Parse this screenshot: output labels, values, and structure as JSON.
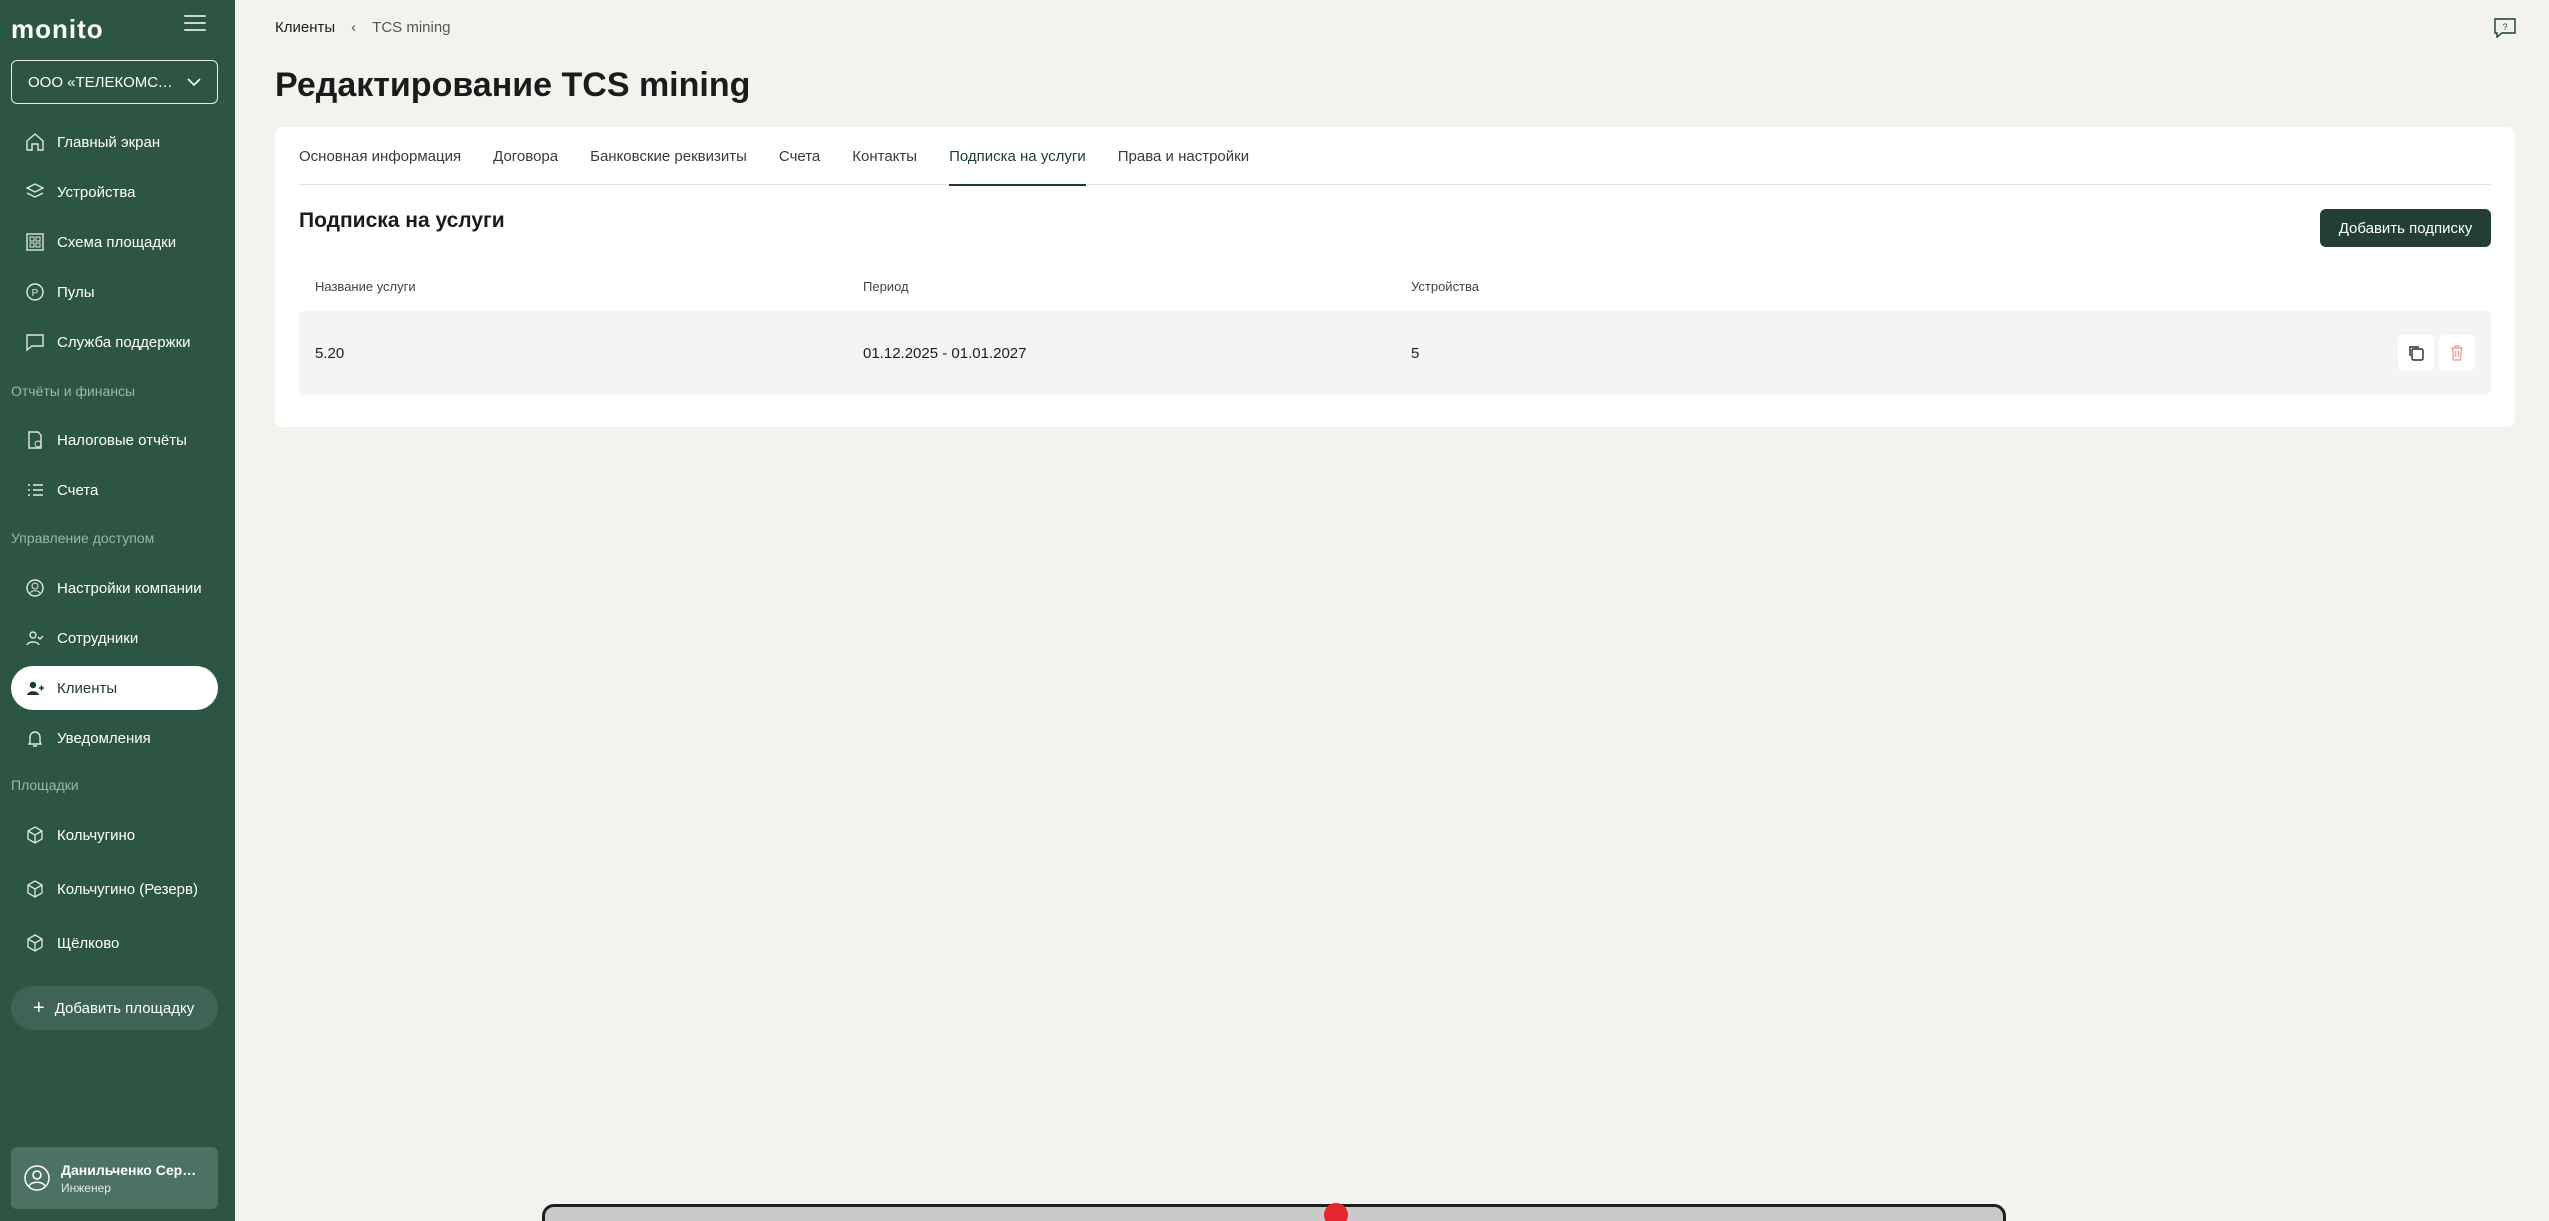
{
  "app": {
    "logo": "monito"
  },
  "company_selector": {
    "value": "ООО «ТЕЛЕКОМСТАНДАРТ»"
  },
  "sidebar": {
    "items": [
      {
        "label": "Главный экран",
        "icon": "home-icon"
      },
      {
        "label": "Устройства",
        "icon": "layers-icon"
      },
      {
        "label": "Схема площадки",
        "icon": "grid-icon"
      },
      {
        "label": "Пулы",
        "icon": "pool-icon"
      },
      {
        "label": "Служба поддержки",
        "icon": "chat-icon"
      }
    ],
    "section_finance": "Отчёты и финансы",
    "finance_items": [
      {
        "label": "Налоговые отчёты",
        "icon": "tax-report-icon"
      },
      {
        "label": "Счета",
        "icon": "list-icon"
      }
    ],
    "section_access": "Управление доступом",
    "access_items": [
      {
        "label": "Настройки компании",
        "icon": "user-circle-icon"
      },
      {
        "label": "Сотрудники",
        "icon": "employees-icon"
      },
      {
        "label": "Клиенты",
        "icon": "clients-icon",
        "active": true
      },
      {
        "label": "Уведомления",
        "icon": "bell-icon"
      }
    ],
    "section_sites": "Площадки",
    "sites": [
      {
        "label": "Кольчугино",
        "icon": "cube-icon"
      },
      {
        "label": "Кольчугино (Резерв)",
        "icon": "cube-icon"
      },
      {
        "label": "Щёлково",
        "icon": "cube-icon"
      }
    ],
    "add_site": "Добавить площадку"
  },
  "user": {
    "name": "Данильченко Сергей",
    "role": "Инженер"
  },
  "breadcrumb": {
    "parent": "Клиенты",
    "separator": "‹",
    "current": "TCS mining"
  },
  "page_title": "Редактирование TCS mining",
  "tabs": [
    {
      "label": "Основная информация"
    },
    {
      "label": "Договора"
    },
    {
      "label": "Банковские реквизиты"
    },
    {
      "label": "Счета"
    },
    {
      "label": "Контакты"
    },
    {
      "label": "Подписка на услуги",
      "active": true
    },
    {
      "label": "Права и настройки"
    }
  ],
  "subscriptions": {
    "title": "Подписка на услуги",
    "add_button": "Добавить подписку",
    "columns": [
      "Название услуги",
      "Период",
      "Устройства"
    ],
    "rows": [
      {
        "name": "5.20",
        "period": "01.12.2025 - 01.01.2027",
        "devices": "5"
      }
    ]
  },
  "colors": {
    "sidebar": "#2c5544",
    "accent": "#233f34",
    "background": "#f3f3ee",
    "delete": "#e8a89a"
  }
}
